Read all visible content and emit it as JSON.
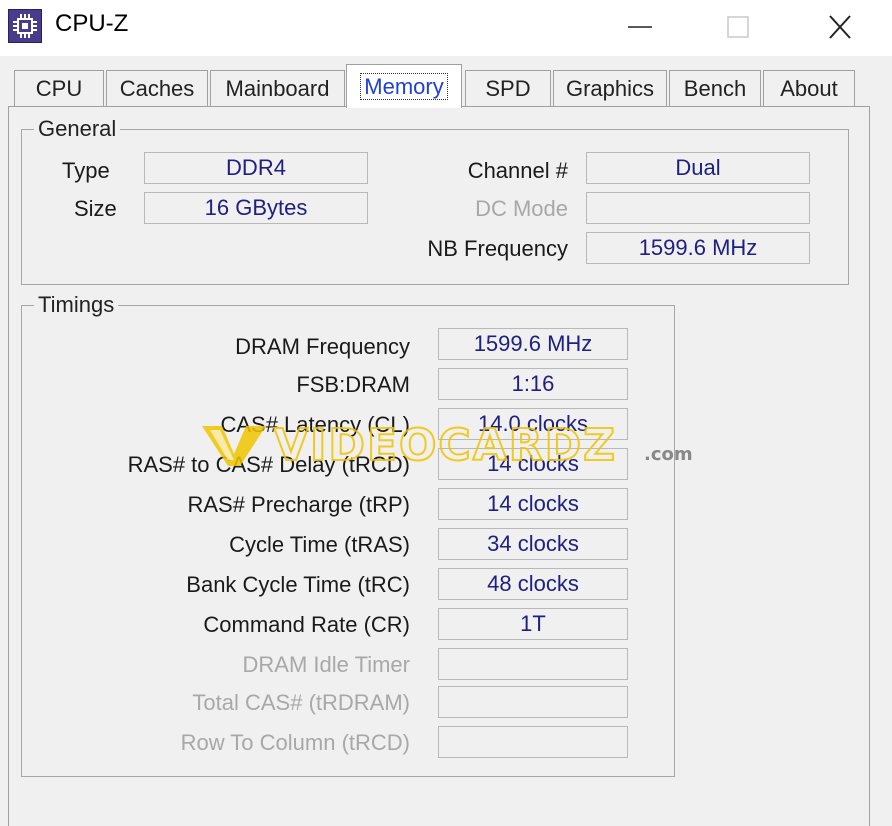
{
  "window": {
    "title": "CPU-Z"
  },
  "tabs": [
    {
      "label": "CPU"
    },
    {
      "label": "Caches"
    },
    {
      "label": "Mainboard"
    },
    {
      "label": "Memory"
    },
    {
      "label": "SPD"
    },
    {
      "label": "Graphics"
    },
    {
      "label": "Bench"
    },
    {
      "label": "About"
    }
  ],
  "general": {
    "title": "General",
    "type_label": "Type",
    "type_value": "DDR4",
    "size_label": "Size",
    "size_value": "16 GBytes",
    "channel_label": "Channel #",
    "channel_value": "Dual",
    "dc_mode_label": "DC Mode",
    "dc_mode_value": "",
    "nb_freq_label": "NB Frequency",
    "nb_freq_value": "1599.6 MHz"
  },
  "timings": {
    "title": "Timings",
    "rows": [
      {
        "label": "DRAM Frequency",
        "value": "1599.6 MHz"
      },
      {
        "label": "FSB:DRAM",
        "value": "1:16"
      },
      {
        "label": "CAS# Latency (CL)",
        "value": "14.0 clocks"
      },
      {
        "label": "RAS# to CAS# Delay (tRCD)",
        "value": "14 clocks"
      },
      {
        "label": "RAS# Precharge (tRP)",
        "value": "14 clocks"
      },
      {
        "label": "Cycle Time (tRAS)",
        "value": "34 clocks"
      },
      {
        "label": "Bank Cycle Time (tRC)",
        "value": "48 clocks"
      },
      {
        "label": "Command Rate (CR)",
        "value": "1T"
      },
      {
        "label": "DRAM Idle Timer",
        "value": ""
      },
      {
        "label": "Total CAS# (tRDRAM)",
        "value": ""
      },
      {
        "label": "Row To Column (tRCD)",
        "value": ""
      }
    ]
  },
  "watermark": {
    "text": "VIDEOCARDZ",
    "suffix": ".com"
  },
  "colors": {
    "value_text": "#202080",
    "active_tab": "#1f3fd8",
    "watermark": "#f0c400"
  }
}
